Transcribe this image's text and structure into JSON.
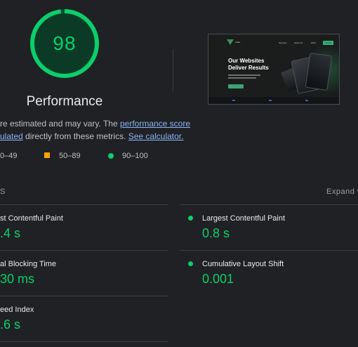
{
  "gauge": {
    "score": "98",
    "label": "Performance",
    "color": "#0cce6b"
  },
  "description": {
    "line1_text": "re estimated and may vary. The ",
    "line1_link": "performance score",
    "line2_link": "ulated",
    "line2_text": " directly from these metrics. ",
    "line2_link2": "See calculator."
  },
  "legend": [
    {
      "range": "0–49",
      "icon": "fail-triangle-icon",
      "color": "#ff4e42"
    },
    {
      "range": "50–89",
      "icon": "average-square-icon",
      "color": "#ffa400"
    },
    {
      "range": "90–100",
      "icon": "pass-circle-icon",
      "color": "#0cce6b"
    }
  ],
  "metrics_section": {
    "label": "S",
    "expand": "Expand v"
  },
  "metrics": [
    {
      "label": "st Contentful Paint",
      "value": ".4 s"
    },
    {
      "label": "Largest Contentful Paint",
      "value": "0.8 s"
    },
    {
      "label": "al Blocking Time",
      "value": "30 ms"
    },
    {
      "label": "Cumulative Layout Shift",
      "value": "0.001"
    },
    {
      "label": "eed Index",
      "value": ".6 s"
    }
  ],
  "screenshot": {
    "brand": "solka",
    "nav": [
      "Services",
      "About Us",
      "Work"
    ],
    "cta": "Contact",
    "headline_1": "Our Websites",
    "headline_2": "Deliver Results"
  }
}
